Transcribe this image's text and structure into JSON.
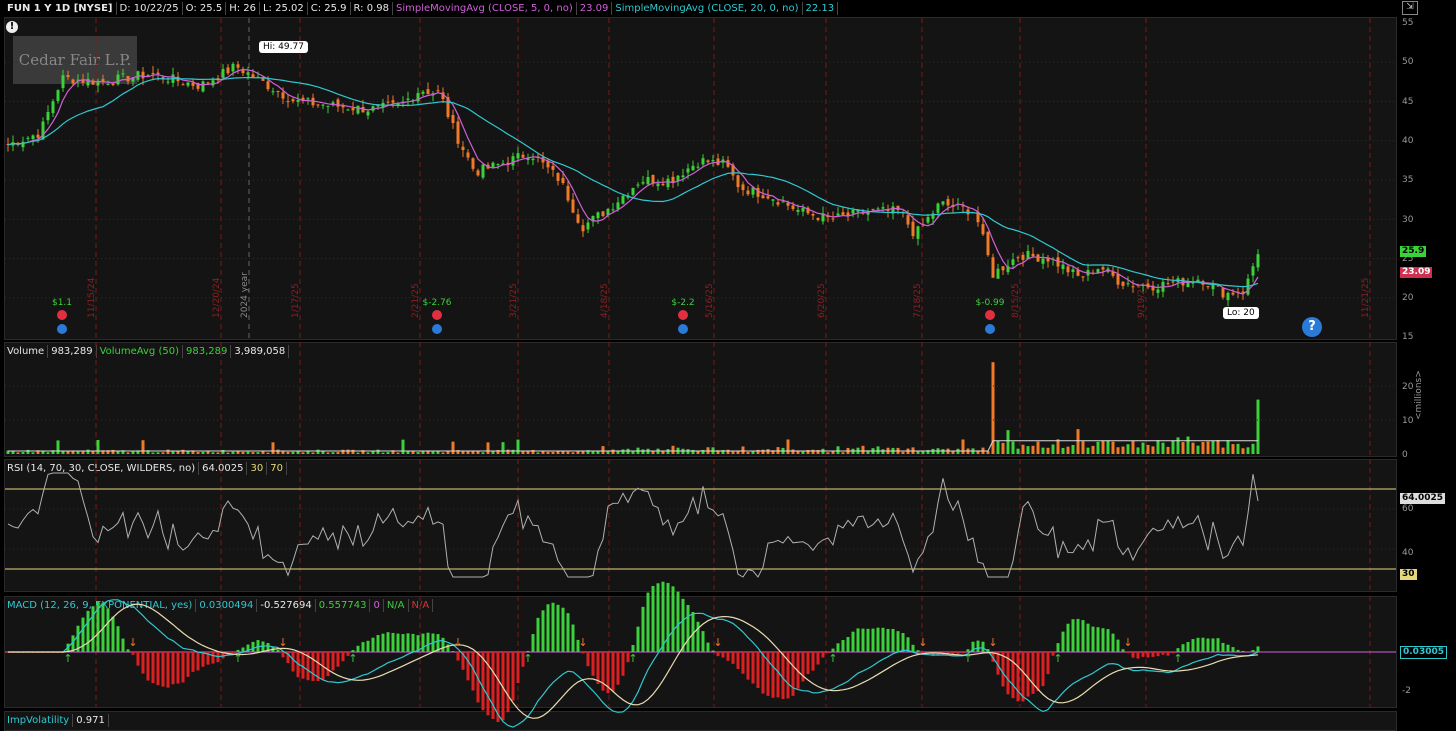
{
  "header": {
    "symbol": "FUN 1 Y 1D [NYSE]",
    "date": "D: 10/22/25",
    "open": "O: 25.5",
    "high": "H: 26",
    "low": "L: 25.02",
    "close": "C: 25.9",
    "range": "R: 0.98",
    "sma5_label": "SimpleMovingAvg (CLOSE, 5, 0, no)",
    "sma5_value": "23.09",
    "sma20_label": "SimpleMovingAvg (CLOSE, 20, 0, no)",
    "sma20_value": "22.13"
  },
  "price_pane": {
    "logo_text": "Cedar Fair L.P.",
    "hi_label": "Hi: 49.77",
    "lo_label": "Lo: 20",
    "year_label": "2024 year",
    "price_ticks": [
      "55",
      "50",
      "45",
      "40",
      "35",
      "30",
      "25",
      "20",
      "15"
    ],
    "price_tag": "25.9",
    "sma_tag": "23.09",
    "date_labels": [
      "11/15/24",
      "12/20/24",
      "1/17/25",
      "2/21/25",
      "3/21/25",
      "4/18/25",
      "5/16/25",
      "6/20/25",
      "7/18/25",
      "8/15/25",
      "9/19/25",
      "11/21/25"
    ],
    "dividends": [
      "$1.1",
      "$-2.76",
      "$-2.2",
      "$-0.99"
    ],
    "help": "?"
  },
  "volume_pane": {
    "label": "Volume",
    "value": "983,289",
    "avg_label": "VolumeAvg (50)",
    "avg_value": "983,289",
    "total": "3,989,058",
    "ticks": [
      "20",
      "10",
      "0"
    ],
    "unit": "<millions>"
  },
  "rsi_pane": {
    "label": "RSI (14, 70, 30, CLOSE, WILDERS, no)",
    "value": "64.0025",
    "lower": "30",
    "upper": "70",
    "ticks": [
      "60",
      "40"
    ],
    "tag": "64.0025",
    "tag30": "30"
  },
  "macd_pane": {
    "label": "MACD (12, 26, 9, EXPONENTIAL, yes)",
    "value": "0.0300494",
    "avg": "-0.527694",
    "diff": "0.557743",
    "zero": "0",
    "na1": "N/A",
    "na2": "N/A",
    "ticks": [
      "-2"
    ],
    "tag": "0.03005"
  },
  "iv_pane": {
    "label": "ImpVolatility",
    "value": "0.971"
  },
  "colors": {
    "up": "#3bd13b",
    "down": "#f07a28",
    "sma5": "#d060d8",
    "sma20": "#30c8d0",
    "grid": "#2e2e2e",
    "vline": "#7a1a1a"
  }
}
